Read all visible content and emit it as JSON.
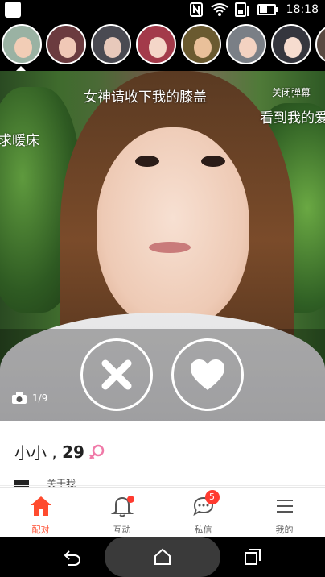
{
  "status_bar": {
    "time": "18:18",
    "icons": [
      "nfc-icon",
      "wifi-icon",
      "phone-signal-icon",
      "battery-icon"
    ]
  },
  "avatars": {
    "count": 8,
    "selected_index": 0
  },
  "photo": {
    "danmaku": [
      "女神请收下我的膝盖",
      "看到我的爱",
      "求暖床"
    ],
    "close_danmaku_label": "关闭弹幕",
    "photo_counter": "1/9",
    "dislike_icon": "close-x-icon",
    "like_icon": "heart-icon"
  },
  "profile": {
    "name": "小小",
    "age_sep": " , ",
    "age": "29",
    "gender_icon": "female-icon",
    "peek_text": "关于我"
  },
  "bottom_nav": {
    "items": [
      {
        "label": "配对",
        "icon": "home-icon",
        "active": true
      },
      {
        "label": "互动",
        "icon": "bell-icon",
        "badge_dot": true
      },
      {
        "label": "私信",
        "icon": "chat-bubble-icon",
        "badge_count": "5"
      },
      {
        "label": "我的",
        "icon": "menu-lines-icon"
      }
    ]
  },
  "colors": {
    "accent": "#ff4b2e",
    "badge": "#ff3b30",
    "female_pink": "#f07aa8"
  }
}
